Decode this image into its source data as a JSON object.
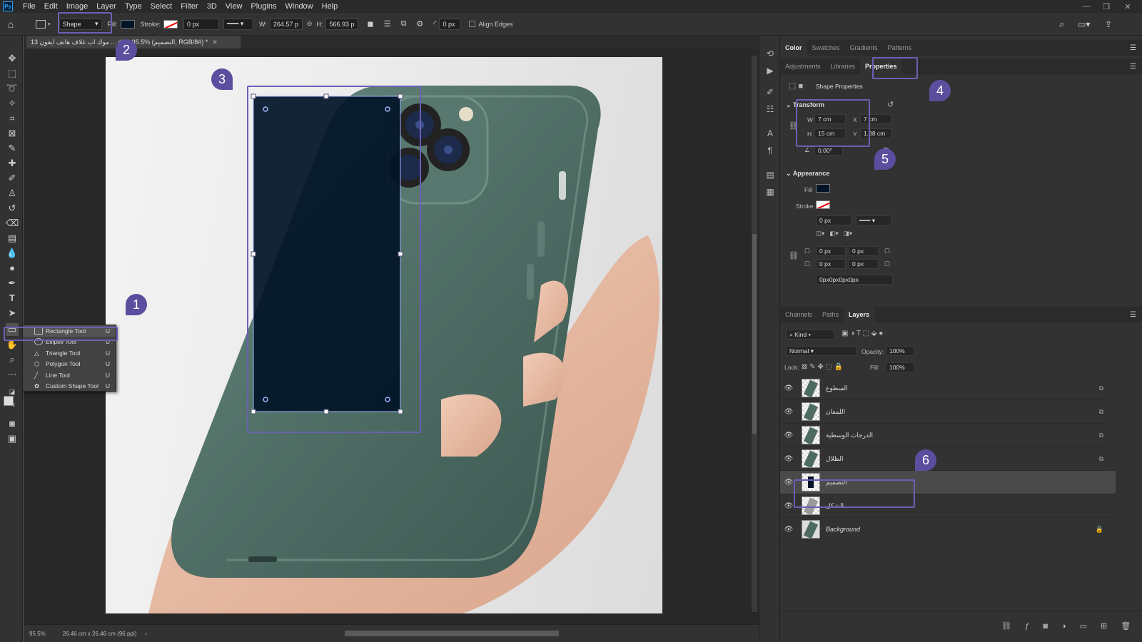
{
  "menubar": {
    "logo": "Ps",
    "items": [
      "File",
      "Edit",
      "Image",
      "Layer",
      "Type",
      "Select",
      "Filter",
      "3D",
      "View",
      "Plugins",
      "Window",
      "Help"
    ]
  },
  "options": {
    "mode": "Shape",
    "fill_label": "Fill:",
    "stroke_label": "Stroke:",
    "stroke_width": "0 px",
    "w_label": "W:",
    "w_value": "264.57 p",
    "h_label": "H:",
    "h_value": "566.93 p",
    "radius": "0 px",
    "align_edges": "Align Edges"
  },
  "document": {
    "tab_title": "13 موك اب غلاف هاتف ايفون ... d @ 95.5% (التصميم, RGB/8#) *",
    "zoom": "95.5%",
    "doc_size": "26.46 cm x 26.46 cm (96 ppi)"
  },
  "flyout": [
    {
      "label": "Rectangle Tool",
      "key": "U"
    },
    {
      "label": "Ellipse Tool",
      "key": "U"
    },
    {
      "label": "Triangle Tool",
      "key": "U"
    },
    {
      "label": "Polygon Tool",
      "key": "U"
    },
    {
      "label": "Line Tool",
      "key": "U"
    },
    {
      "label": "Custom Shape Tool",
      "key": "U"
    }
  ],
  "panels": {
    "top_tabs": [
      "Color",
      "Swatches",
      "Gradients",
      "Patterns"
    ],
    "mid_tabs": [
      "Adjustments",
      "Libraries",
      "Properties"
    ],
    "shape_properties": "Shape Properties",
    "transform": {
      "title": "Transform",
      "w_label": "W",
      "w": "7 cm",
      "x_label": "X",
      "x": "7 cm",
      "h_label": "H",
      "h": "15 cm",
      "y_label": "Y",
      "y": "1.88 cm",
      "angle": "0.00°"
    },
    "appearance": {
      "title": "Appearance",
      "fill_label": "Fill",
      "stroke_label": "Stroke",
      "stroke_width": "0 px",
      "r1": "0 px",
      "r2": "0 px",
      "r3": "0 px",
      "r4": "0 px",
      "radii": "0px0px0px0px"
    },
    "layer_tabs": [
      "Channels",
      "Paths",
      "Layers"
    ],
    "kind": "Kind",
    "blend": "Normal",
    "opacity_label": "Opacity:",
    "opacity": "100%",
    "lock_label": "Lock:",
    "fill_label": "Fill:",
    "fill": "100%",
    "layers": [
      {
        "name": "السطوع"
      },
      {
        "name": "اللمعان"
      },
      {
        "name": "الدرجات الوسطية"
      },
      {
        "name": "الظلال"
      },
      {
        "name": "التصميم"
      },
      {
        "name": "الشكل"
      },
      {
        "name": "Background"
      }
    ]
  },
  "badges": [
    "1",
    "2",
    "3",
    "4",
    "5",
    "6"
  ],
  "colors": {
    "shape_fill": "#021428",
    "highlight": "#6b5fb5",
    "phone": "#4d6b63"
  }
}
